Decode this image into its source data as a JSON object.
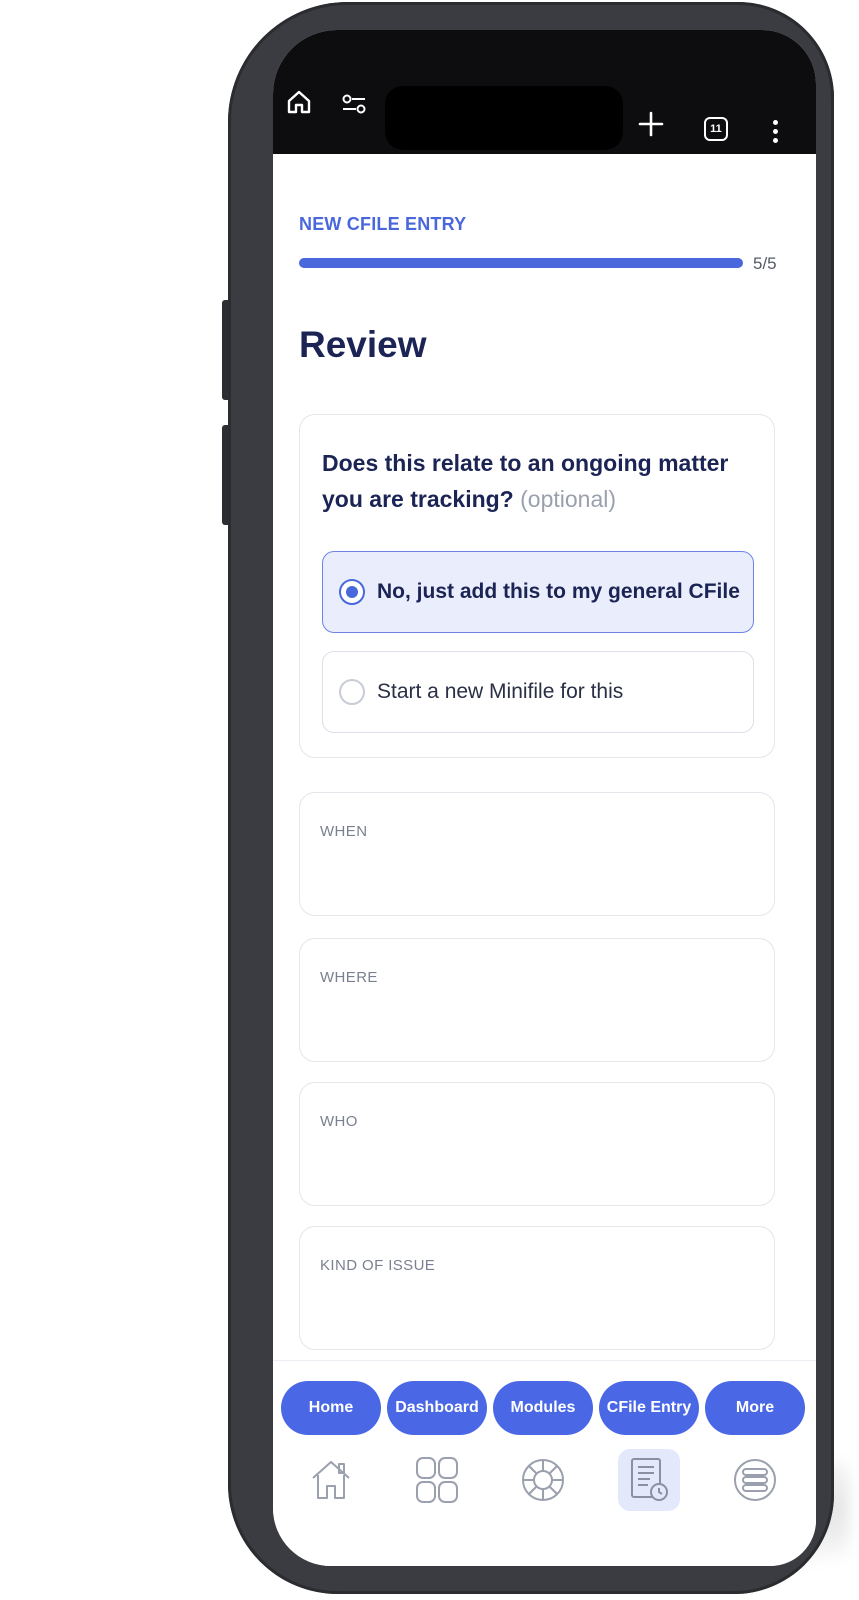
{
  "browser": {
    "tab_count": "11",
    "icons": [
      "home-icon",
      "tune-icon",
      "plus-icon",
      "tab-switcher-icon",
      "kebab-menu-icon"
    ]
  },
  "header": {
    "eyebrow": "NEW CFILE ENTRY",
    "step_label": "5/5",
    "progress_fraction": 1.0,
    "title": "Review"
  },
  "question": {
    "text": "Does this relate to an ongoing matter you are tracking?",
    "optional": "(optional)",
    "options": [
      {
        "label": "No, just add this to my general CFile",
        "selected": true
      },
      {
        "label": "Start a new Minifile for this",
        "selected": false
      }
    ]
  },
  "fields": [
    {
      "label": "WHEN"
    },
    {
      "label": "WHERE"
    },
    {
      "label": "WHO"
    },
    {
      "label": "KIND OF ISSUE"
    }
  ],
  "nav": {
    "items": [
      {
        "label": "Home",
        "icon": "house-icon",
        "active": false
      },
      {
        "label": "Dashboard",
        "icon": "grid-icon",
        "active": false
      },
      {
        "label": "Modules",
        "icon": "wheel-icon",
        "active": false
      },
      {
        "label": "CFile Entry",
        "icon": "document-clock-icon",
        "active": true
      },
      {
        "label": "More",
        "icon": "stack-icon",
        "active": false
      }
    ]
  },
  "colors": {
    "accent": "#4a67dc",
    "nav_pill": "#4a67e6",
    "title": "#1b2454",
    "selected_bg": "#eaeefc"
  }
}
